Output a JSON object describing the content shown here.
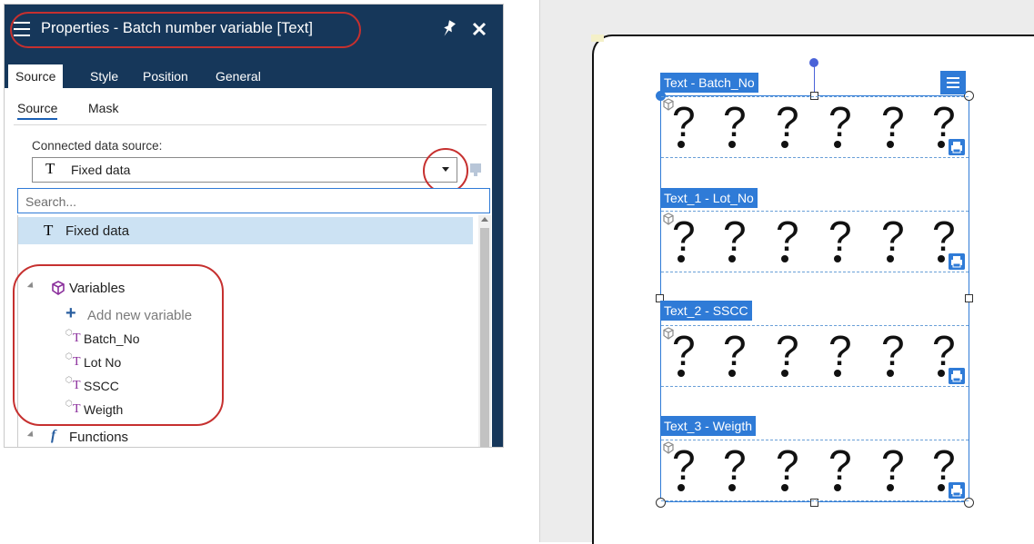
{
  "panel": {
    "title": "Properties - Batch number variable [Text]",
    "main_tabs": [
      {
        "label": "Source",
        "active": true
      },
      {
        "label": "Style",
        "active": false
      },
      {
        "label": "Position",
        "active": false
      },
      {
        "label": "General",
        "active": false
      }
    ],
    "sub_tabs": [
      {
        "label": "Source",
        "active": true
      },
      {
        "label": "Mask",
        "active": false
      }
    ],
    "data_source_label": "Connected data source:",
    "data_source_value": "Fixed data",
    "search_placeholder": "Search...",
    "list": {
      "fixed_data": "Fixed data",
      "variables_group": "Variables",
      "add_new_variable": "Add new variable",
      "variables": [
        "Batch_No",
        "Lot No",
        "SSCC",
        "Weigth"
      ],
      "functions_group": "Functions"
    },
    "colors": {
      "titlebar": "#16375a",
      "selection": "#cce2f3",
      "annotation": "#c6302f",
      "accent": "#2f7bd7"
    }
  },
  "designer": {
    "objects": [
      {
        "tag": "Text - Batch_No"
      },
      {
        "tag": "Text_1 - Lot_No"
      },
      {
        "tag": "Text_2 - SSCC"
      },
      {
        "tag": "Text_3 - Weigth"
      }
    ],
    "placeholder_char": "?"
  }
}
